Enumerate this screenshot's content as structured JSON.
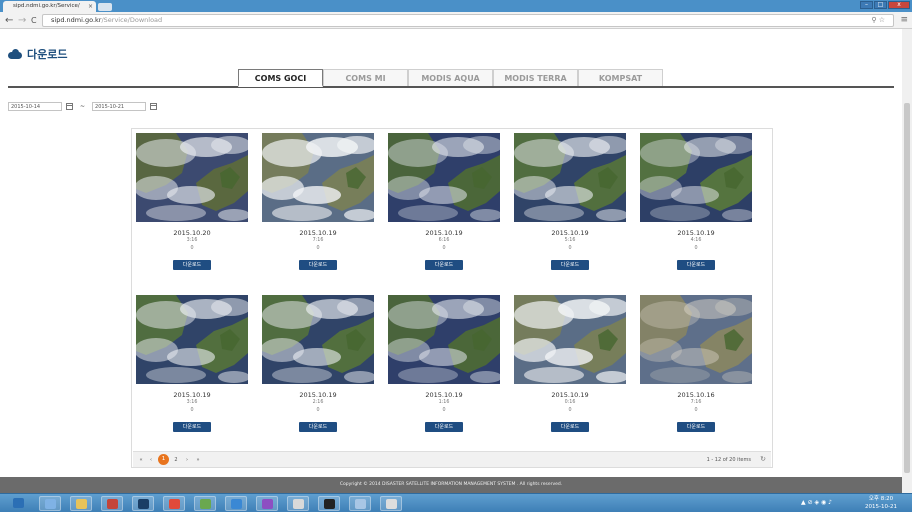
{
  "browser": {
    "tab_title": "sipd.ndmi.go.kr/Service/",
    "tab_close": "×",
    "url_host": "sipd.ndmi.go.kr",
    "url_path": "/Service/Download",
    "back": "←",
    "forward": "→",
    "reload": "C",
    "zoom_icon": "⚲",
    "star_icon": "☆",
    "menu_icon": "≡",
    "win_min": "–",
    "win_max": "□",
    "win_close": "x"
  },
  "page": {
    "heading": "다운로드",
    "tabs": [
      {
        "label": "COMS GOCI",
        "active": true
      },
      {
        "label": "COMS MI",
        "active": false
      },
      {
        "label": "MODIS AQUA",
        "active": false
      },
      {
        "label": "MODIS TERRA",
        "active": false
      },
      {
        "label": "KOMPSAT",
        "active": false
      }
    ],
    "date_from": "2015-10-14",
    "date_to": "2015-10-21",
    "date_sep": "~",
    "download_label": "다운로드",
    "items": [
      {
        "date": "2015.10.20",
        "time": "3:16",
        "count": "0",
        "variant": 0
      },
      {
        "date": "2015.10.19",
        "time": "7:16",
        "count": "0",
        "variant": 1
      },
      {
        "date": "2015.10.19",
        "time": "6:16",
        "count": "0",
        "variant": 2
      },
      {
        "date": "2015.10.19",
        "time": "5:16",
        "count": "0",
        "variant": 3
      },
      {
        "date": "2015.10.19",
        "time": "4:16",
        "count": "0",
        "variant": 4
      },
      {
        "date": "2015.10.19",
        "time": "3:16",
        "count": "0",
        "variant": 3
      },
      {
        "date": "2015.10.19",
        "time": "2:16",
        "count": "0",
        "variant": 3
      },
      {
        "date": "2015.10.19",
        "time": "1:16",
        "count": "0",
        "variant": 2
      },
      {
        "date": "2015.10.19",
        "time": "0:16",
        "count": "0",
        "variant": 1
      },
      {
        "date": "2015.10.16",
        "time": "7:16",
        "count": "0",
        "variant": 5
      }
    ],
    "pager": {
      "first": "«",
      "prev": "‹",
      "current": "1",
      "page2": "2",
      "next": "›",
      "last": "»",
      "info": "1 - 12 of 20 items",
      "refresh": "↻"
    },
    "footer": "Copyright © 2014 DISASTER SATELLITE INFORMATION MANAGEMENT SYSTEM . All rights reserved."
  },
  "taskbar": {
    "tray_icons": "▲ ⊘ ◈ ◉ ♪",
    "clock_ampm": "오후 8:20",
    "clock_date": "2015-10-21",
    "apps": [
      {
        "name": "start",
        "color": "#2b6fb5"
      },
      {
        "name": "network",
        "color": "#7fb2e5"
      },
      {
        "name": "explorer",
        "color": "#e8c35a"
      },
      {
        "name": "media",
        "color": "#c4453a"
      },
      {
        "name": "ssh",
        "color": "#1a3e66"
      },
      {
        "name": "chrome",
        "color": "#e04a3a"
      },
      {
        "name": "app7",
        "color": "#6aa84f"
      },
      {
        "name": "ie",
        "color": "#3a88d4"
      },
      {
        "name": "vs",
        "color": "#8d4fc2"
      },
      {
        "name": "app10",
        "color": "#d9d9d9"
      },
      {
        "name": "cmd",
        "color": "#222222"
      },
      {
        "name": "app12",
        "color": "#a8c6e5"
      },
      {
        "name": "app13",
        "color": "#dddddd"
      }
    ]
  }
}
